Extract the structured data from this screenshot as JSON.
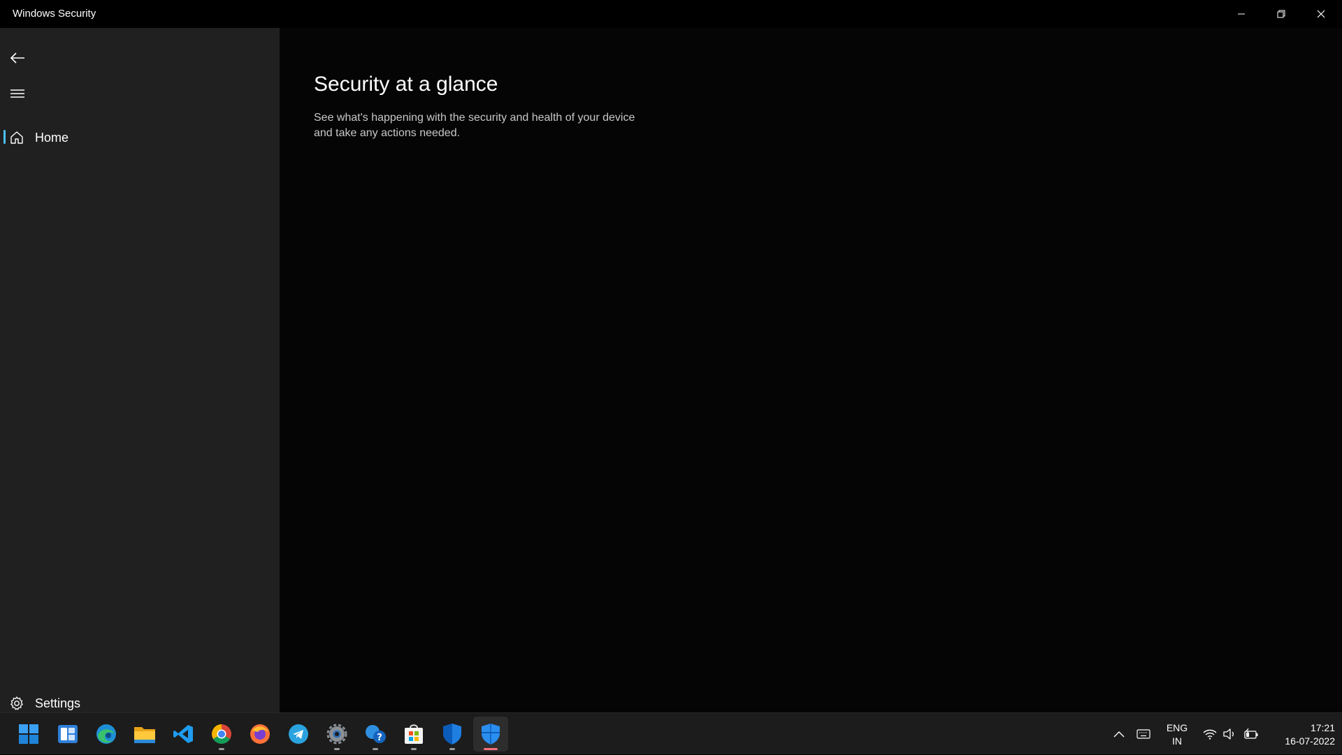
{
  "window": {
    "title": "Windows Security"
  },
  "titlebar_controls": [
    {
      "name": "minimize-icon"
    },
    {
      "name": "restore-icon"
    },
    {
      "name": "close-icon"
    }
  ],
  "sidebar": {
    "back_icon": "back-arrow-icon",
    "menu_icon": "hamburger-menu-icon",
    "items": [
      {
        "label": "Home",
        "icon": "home-icon",
        "selected": true
      }
    ],
    "settings": {
      "label": "Settings",
      "icon": "gear-icon"
    }
  },
  "main": {
    "title": "Security at a glance",
    "description": "See what's happening with the security and health of your device and take any actions needed."
  },
  "taskbar": {
    "apps": [
      {
        "name": "start-icon",
        "running": false
      },
      {
        "name": "widgets-icon",
        "running": false
      },
      {
        "name": "edge-icon",
        "running": false
      },
      {
        "name": "file-explorer-icon",
        "running": false
      },
      {
        "name": "vscode-icon",
        "running": false
      },
      {
        "name": "chrome-icon",
        "running": true
      },
      {
        "name": "firefox-icon",
        "running": false
      },
      {
        "name": "telegram-icon",
        "running": false
      },
      {
        "name": "settings-app-icon",
        "running": true
      },
      {
        "name": "get-help-icon",
        "running": true
      },
      {
        "name": "microsoft-store-icon",
        "running": true
      },
      {
        "name": "defender-shield-icon",
        "running": true
      },
      {
        "name": "windows-security-icon",
        "running": true,
        "active": true
      }
    ],
    "tray": {
      "icons": [
        "chevron-up-icon",
        "keyboard-icon",
        "wifi-icon",
        "volume-icon",
        "battery-icon"
      ],
      "language": "ENG",
      "region": "IN",
      "time": "17:21",
      "date": "16-07-2022"
    },
    "accent_color": "#f1707b"
  },
  "colors": {
    "sidebar_bg": "#202020",
    "main_bg": "#050505",
    "selection_indicator": "#4cc2ff"
  }
}
